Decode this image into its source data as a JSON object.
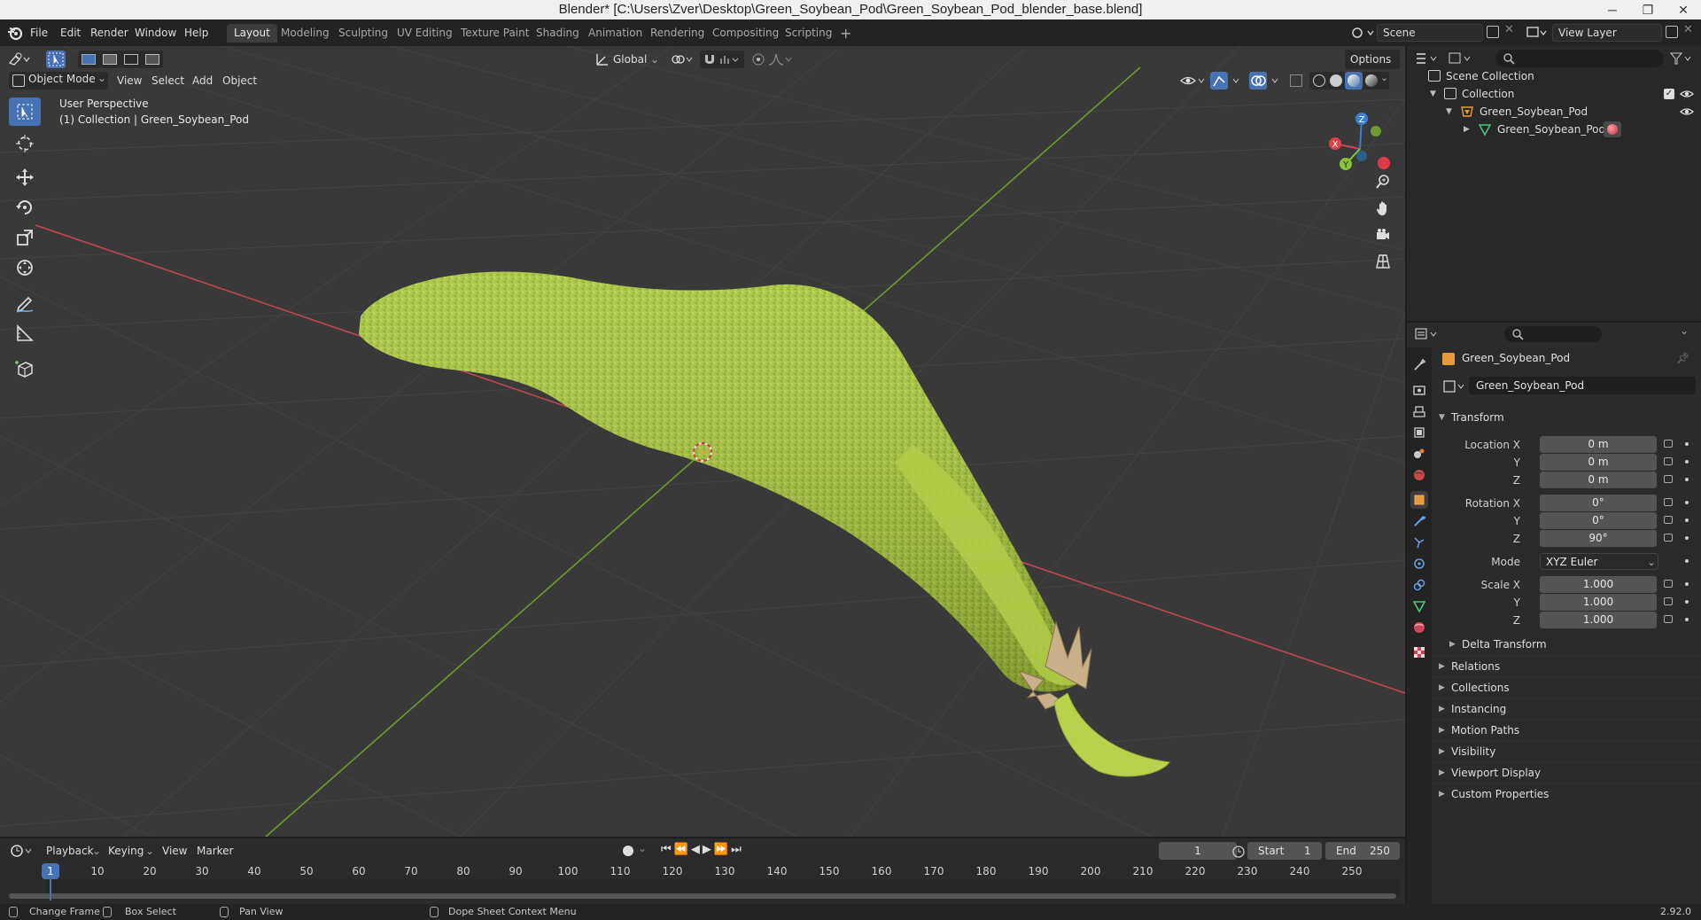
{
  "window": {
    "title": "Blender* [C:\\Users\\Zver\\Desktop\\Green_Soybean_Pod\\Green_Soybean_Pod_blender_base.blend]",
    "minimize": "─",
    "restore": "❐",
    "close": "✕"
  },
  "menu": [
    "File",
    "Edit",
    "Render",
    "Window",
    "Help"
  ],
  "workspaces": [
    "Layout",
    "Modeling",
    "Sculpting",
    "UV Editing",
    "Texture Paint",
    "Shading",
    "Animation",
    "Rendering",
    "Compositing",
    "Scripting"
  ],
  "active_workspace": "Layout",
  "add_workspace": "+",
  "scene": {
    "label": "Scene",
    "view_layer": "View Layer"
  },
  "viewport_header": {
    "orientation": "Global",
    "options": "Options",
    "mode": "Object Mode",
    "menus": [
      "View",
      "Select",
      "Add",
      "Object"
    ]
  },
  "viewport": {
    "perspective": "User Perspective",
    "collection_info": "(1) Collection | Green_Soybean_Pod",
    "gizmo": {
      "x": "X",
      "y": "Y",
      "z": "Z"
    },
    "colors": {
      "x_axis": "#c0464f",
      "y_axis": "#6a9a2a",
      "grid": "#454545",
      "pod": "#a6c43a"
    }
  },
  "outliner": {
    "rows": [
      {
        "label": "Scene Collection"
      },
      {
        "label": "Collection"
      },
      {
        "label": "Green_Soybean_Pod"
      },
      {
        "label": "Green_Soybean_Pod"
      }
    ]
  },
  "properties": {
    "object_name": "Green_Soybean_Pod",
    "data_name": "Green_Soybean_Pod",
    "transform_label": "Transform",
    "location": {
      "label": "Location X",
      "x": "0 m",
      "y": "0 m",
      "z": "0 m"
    },
    "rotation": {
      "label": "Rotation X",
      "x": "0°",
      "y": "0°",
      "z": "90°"
    },
    "mode": {
      "label": "Mode",
      "value": "XYZ Euler"
    },
    "scale": {
      "label": "Scale X",
      "x": "1.000",
      "y": "1.000",
      "z": "1.000"
    },
    "axis_y": "Y",
    "axis_z": "Z",
    "delta_transform": "Delta Transform",
    "panels": [
      "Relations",
      "Collections",
      "Instancing",
      "Motion Paths",
      "Visibility",
      "Viewport Display",
      "Custom Properties"
    ]
  },
  "timeline": {
    "menus": [
      "Playback",
      "Keying",
      "View",
      "Marker"
    ],
    "current_frame": "1",
    "start_label": "Start",
    "start": "1",
    "end_label": "End",
    "end": "250",
    "ticks": [
      "10",
      "20",
      "30",
      "40",
      "50",
      "60",
      "70",
      "80",
      "90",
      "100",
      "110",
      "120",
      "130",
      "140",
      "150",
      "160",
      "170",
      "180",
      "190",
      "200",
      "210",
      "220",
      "230",
      "240",
      "250"
    ],
    "playhead": "1"
  },
  "status": {
    "change_frame": "Change Frame",
    "box_select": "Box Select",
    "pan_view": "Pan View",
    "context_menu": "Dope Sheet Context Menu",
    "version": "2.92.0"
  }
}
